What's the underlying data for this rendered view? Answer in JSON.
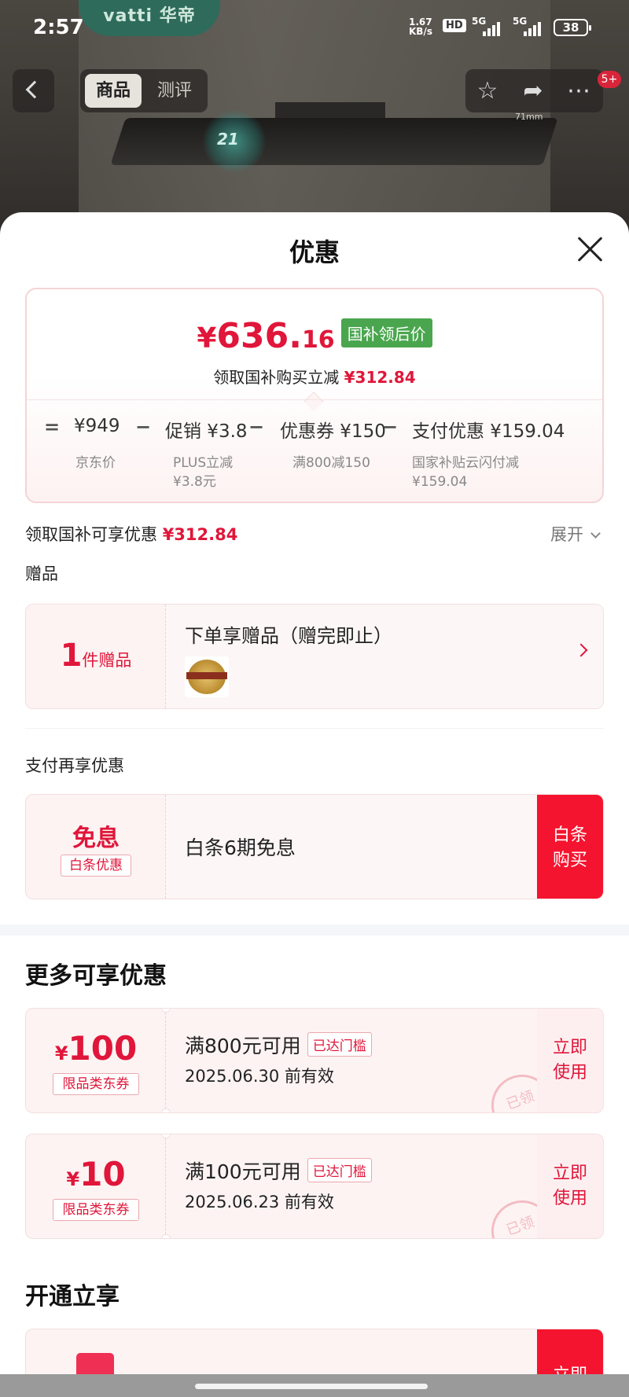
{
  "status_bar": {
    "time": "2:57",
    "net_speed_top": "1.67",
    "net_speed_bottom": "KB/s",
    "hd": "HD",
    "signal1": "5G",
    "signal2": "5G",
    "battery": "38"
  },
  "background": {
    "brand": "vatti 华帝",
    "glow_label": "21",
    "dim_label": "71mm"
  },
  "nav": {
    "tab_product": "商品",
    "tab_review": "测评",
    "message_badge": "5+"
  },
  "sheet": {
    "title": "优惠",
    "price": {
      "currency": "¥",
      "integer": "636.",
      "decimal": "16",
      "tag": "国补领后价",
      "save_text": "领取国补购买立减",
      "save_amount": "¥312.84"
    },
    "breakdown": {
      "eq": "=",
      "jd_price": "¥949",
      "jd_price_label": "京东价",
      "promo": "促销 ¥3.8",
      "promo_label_1": "PLUS立减",
      "promo_label_2": "¥3.8元",
      "coupon": "优惠券 ¥150",
      "coupon_label": "满800减150",
      "pay": "支付优惠 ¥159.04",
      "pay_label_1": "国家补贴云闪付减",
      "pay_label_2": "¥159.04",
      "minus": "−"
    },
    "gov_row": {
      "label": "领取国补可享优惠",
      "amount": "¥312.84",
      "expand": "展开"
    },
    "gift": {
      "section": "赠品",
      "count": "1",
      "count_unit": "件赠品",
      "title": "下单享赠品（赠完即止）"
    },
    "pay_more": {
      "section": "支付再享优惠",
      "left_big": "免息",
      "left_tag": "白条优惠",
      "title": "白条6期免息",
      "button_line1": "白条",
      "button_line2": "购买"
    },
    "more": {
      "title": "更多可享优惠",
      "coupons": [
        {
          "currency": "¥",
          "amount": "100",
          "tag": "限品类东券",
          "title": "满800元可用",
          "threshold": "已达门槛",
          "date": "2025.06.30 前有效",
          "use_line1": "立即",
          "use_line2": "使用",
          "stamp": "已领"
        },
        {
          "currency": "¥",
          "amount": "10",
          "tag": "限品类东券",
          "title": "满100元可用",
          "threshold": "已达门槛",
          "date": "2025.06.23 前有效",
          "use_line1": "立即",
          "use_line2": "使用",
          "stamp": "已领"
        }
      ]
    },
    "open": {
      "title": "开通立享",
      "button": "立即"
    }
  },
  "colors": {
    "accent_red": "#e0163a",
    "gov_green": "#4aa64e"
  }
}
